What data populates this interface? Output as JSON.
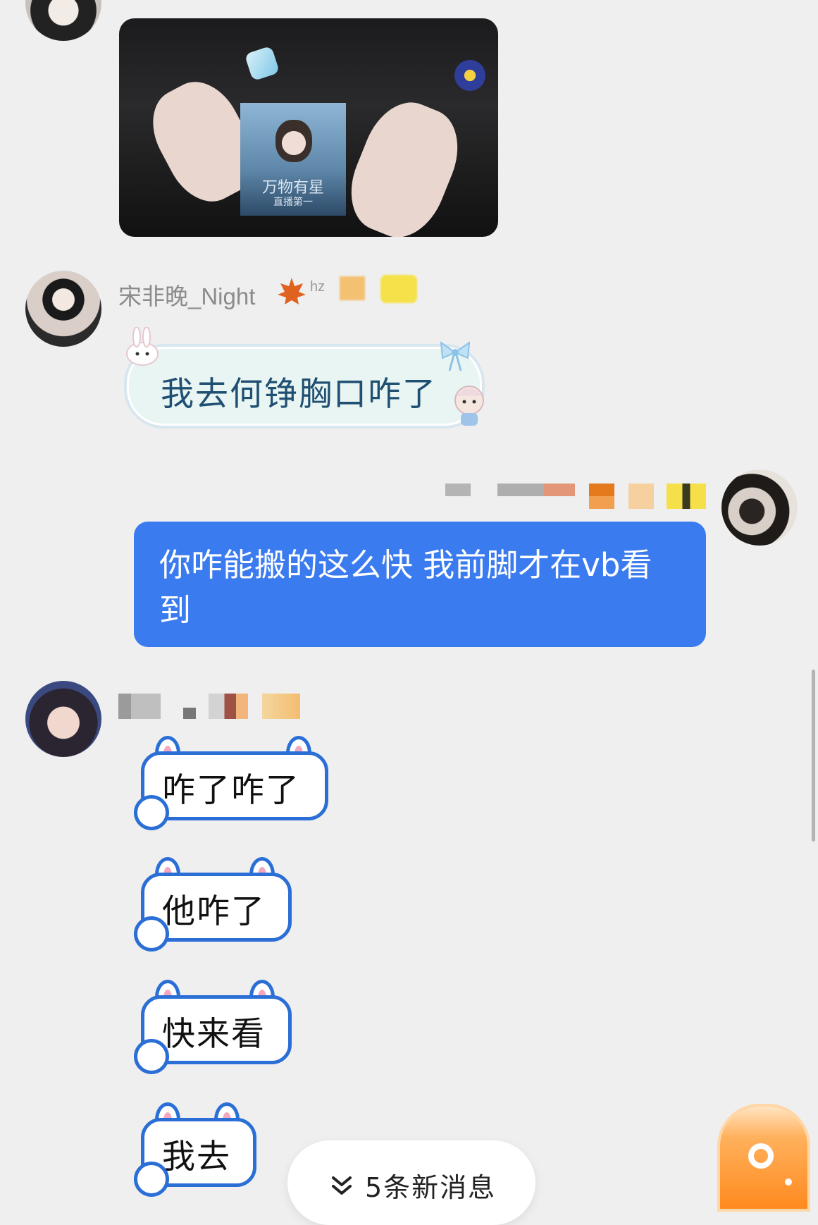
{
  "messages": {
    "video": {
      "poster_title": "万物有星",
      "poster_subtitle": "直播第一"
    },
    "msg1": {
      "sender": "宋非晚_Night",
      "tag": "hz",
      "text": "我去何铮胸口咋了"
    },
    "msg2": {
      "text": "你咋能搬的这么快 我前脚才在vb看到"
    },
    "msg3": {
      "bubbles": [
        "咋了咋了",
        "他咋了",
        "快来看",
        "我去"
      ]
    }
  },
  "new_messages": {
    "label": "5条新消息",
    "icon": "chevron-double-down-icon"
  },
  "colors": {
    "self_bubble": "#3b7bf0",
    "bunny_border": "#2b6fd6",
    "background": "#efefef"
  }
}
